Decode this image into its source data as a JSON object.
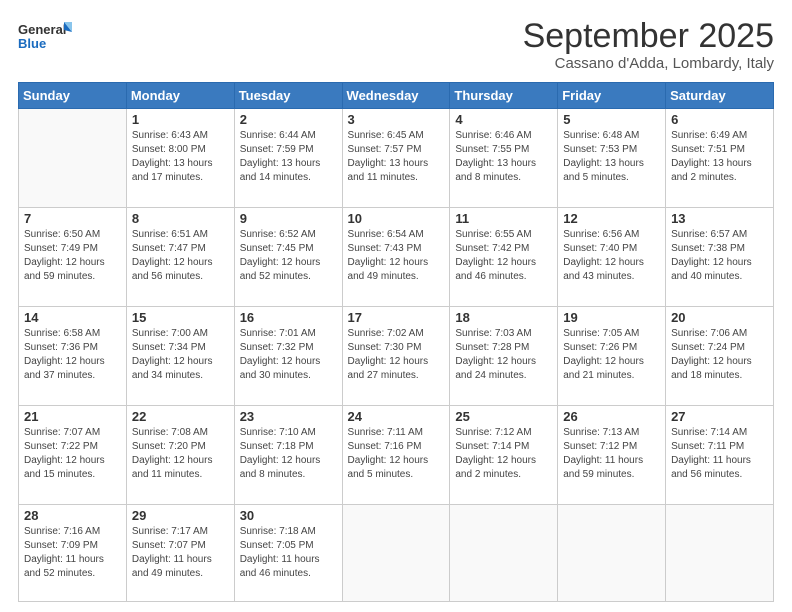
{
  "logo": {
    "line1": "General",
    "line2": "Blue"
  },
  "header": {
    "title": "September 2025",
    "subtitle": "Cassano d'Adda, Lombardy, Italy"
  },
  "weekdays": [
    "Sunday",
    "Monday",
    "Tuesday",
    "Wednesday",
    "Thursday",
    "Friday",
    "Saturday"
  ],
  "weeks": [
    [
      {
        "day": "",
        "info": ""
      },
      {
        "day": "1",
        "info": "Sunrise: 6:43 AM\nSunset: 8:00 PM\nDaylight: 13 hours\nand 17 minutes."
      },
      {
        "day": "2",
        "info": "Sunrise: 6:44 AM\nSunset: 7:59 PM\nDaylight: 13 hours\nand 14 minutes."
      },
      {
        "day": "3",
        "info": "Sunrise: 6:45 AM\nSunset: 7:57 PM\nDaylight: 13 hours\nand 11 minutes."
      },
      {
        "day": "4",
        "info": "Sunrise: 6:46 AM\nSunset: 7:55 PM\nDaylight: 13 hours\nand 8 minutes."
      },
      {
        "day": "5",
        "info": "Sunrise: 6:48 AM\nSunset: 7:53 PM\nDaylight: 13 hours\nand 5 minutes."
      },
      {
        "day": "6",
        "info": "Sunrise: 6:49 AM\nSunset: 7:51 PM\nDaylight: 13 hours\nand 2 minutes."
      }
    ],
    [
      {
        "day": "7",
        "info": "Sunrise: 6:50 AM\nSunset: 7:49 PM\nDaylight: 12 hours\nand 59 minutes."
      },
      {
        "day": "8",
        "info": "Sunrise: 6:51 AM\nSunset: 7:47 PM\nDaylight: 12 hours\nand 56 minutes."
      },
      {
        "day": "9",
        "info": "Sunrise: 6:52 AM\nSunset: 7:45 PM\nDaylight: 12 hours\nand 52 minutes."
      },
      {
        "day": "10",
        "info": "Sunrise: 6:54 AM\nSunset: 7:43 PM\nDaylight: 12 hours\nand 49 minutes."
      },
      {
        "day": "11",
        "info": "Sunrise: 6:55 AM\nSunset: 7:42 PM\nDaylight: 12 hours\nand 46 minutes."
      },
      {
        "day": "12",
        "info": "Sunrise: 6:56 AM\nSunset: 7:40 PM\nDaylight: 12 hours\nand 43 minutes."
      },
      {
        "day": "13",
        "info": "Sunrise: 6:57 AM\nSunset: 7:38 PM\nDaylight: 12 hours\nand 40 minutes."
      }
    ],
    [
      {
        "day": "14",
        "info": "Sunrise: 6:58 AM\nSunset: 7:36 PM\nDaylight: 12 hours\nand 37 minutes."
      },
      {
        "day": "15",
        "info": "Sunrise: 7:00 AM\nSunset: 7:34 PM\nDaylight: 12 hours\nand 34 minutes."
      },
      {
        "day": "16",
        "info": "Sunrise: 7:01 AM\nSunset: 7:32 PM\nDaylight: 12 hours\nand 30 minutes."
      },
      {
        "day": "17",
        "info": "Sunrise: 7:02 AM\nSunset: 7:30 PM\nDaylight: 12 hours\nand 27 minutes."
      },
      {
        "day": "18",
        "info": "Sunrise: 7:03 AM\nSunset: 7:28 PM\nDaylight: 12 hours\nand 24 minutes."
      },
      {
        "day": "19",
        "info": "Sunrise: 7:05 AM\nSunset: 7:26 PM\nDaylight: 12 hours\nand 21 minutes."
      },
      {
        "day": "20",
        "info": "Sunrise: 7:06 AM\nSunset: 7:24 PM\nDaylight: 12 hours\nand 18 minutes."
      }
    ],
    [
      {
        "day": "21",
        "info": "Sunrise: 7:07 AM\nSunset: 7:22 PM\nDaylight: 12 hours\nand 15 minutes."
      },
      {
        "day": "22",
        "info": "Sunrise: 7:08 AM\nSunset: 7:20 PM\nDaylight: 12 hours\nand 11 minutes."
      },
      {
        "day": "23",
        "info": "Sunrise: 7:10 AM\nSunset: 7:18 PM\nDaylight: 12 hours\nand 8 minutes."
      },
      {
        "day": "24",
        "info": "Sunrise: 7:11 AM\nSunset: 7:16 PM\nDaylight: 12 hours\nand 5 minutes."
      },
      {
        "day": "25",
        "info": "Sunrise: 7:12 AM\nSunset: 7:14 PM\nDaylight: 12 hours\nand 2 minutes."
      },
      {
        "day": "26",
        "info": "Sunrise: 7:13 AM\nSunset: 7:12 PM\nDaylight: 11 hours\nand 59 minutes."
      },
      {
        "day": "27",
        "info": "Sunrise: 7:14 AM\nSunset: 7:11 PM\nDaylight: 11 hours\nand 56 minutes."
      }
    ],
    [
      {
        "day": "28",
        "info": "Sunrise: 7:16 AM\nSunset: 7:09 PM\nDaylight: 11 hours\nand 52 minutes."
      },
      {
        "day": "29",
        "info": "Sunrise: 7:17 AM\nSunset: 7:07 PM\nDaylight: 11 hours\nand 49 minutes."
      },
      {
        "day": "30",
        "info": "Sunrise: 7:18 AM\nSunset: 7:05 PM\nDaylight: 11 hours\nand 46 minutes."
      },
      {
        "day": "",
        "info": ""
      },
      {
        "day": "",
        "info": ""
      },
      {
        "day": "",
        "info": ""
      },
      {
        "day": "",
        "info": ""
      }
    ]
  ]
}
